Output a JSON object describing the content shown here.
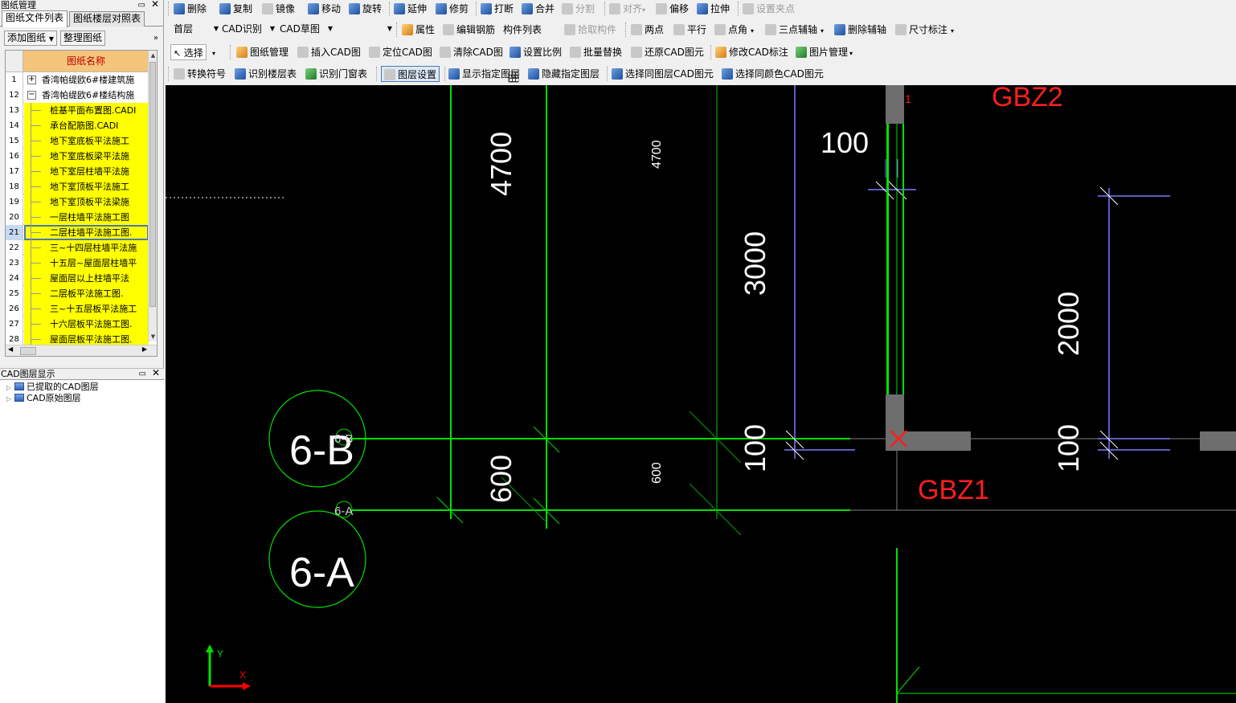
{
  "left_panel": {
    "title": "图纸管理",
    "tabs": [
      "图纸文件列表",
      "图纸楼层对照表"
    ],
    "add_button": "添加图纸",
    "organize_button": "整理图纸",
    "column_header": "图纸名称",
    "rows": [
      {
        "num": "1",
        "name": "香湾帕缇欧6#楼建筑施",
        "kind": "parent",
        "toggle": "+"
      },
      {
        "num": "12",
        "name": "香湾帕缇欧6#楼结构施",
        "kind": "parent",
        "toggle": "−"
      },
      {
        "num": "13",
        "name": "桩基平面布置图.CADI",
        "kind": "child"
      },
      {
        "num": "14",
        "name": "承台配筋图.CADI",
        "kind": "child"
      },
      {
        "num": "15",
        "name": "地下室底板平法施工",
        "kind": "child"
      },
      {
        "num": "16",
        "name": "地下室底板梁平法施",
        "kind": "child"
      },
      {
        "num": "17",
        "name": "地下室层柱墙平法施",
        "kind": "child"
      },
      {
        "num": "18",
        "name": "地下室顶板平法施工",
        "kind": "child"
      },
      {
        "num": "19",
        "name": "地下室顶板平法梁施",
        "kind": "child"
      },
      {
        "num": "20",
        "name": "一层柱墙平法施工图",
        "kind": "child"
      },
      {
        "num": "21",
        "name": "二层柱墙平法施工图.",
        "kind": "child",
        "selected": true
      },
      {
        "num": "22",
        "name": "三~十四层柱墙平法施",
        "kind": "child"
      },
      {
        "num": "23",
        "name": "十五层~屋面层柱墙平",
        "kind": "child"
      },
      {
        "num": "24",
        "name": "屋面层以上柱墙平法",
        "kind": "child"
      },
      {
        "num": "25",
        "name": "二层板平法施工图.",
        "kind": "child"
      },
      {
        "num": "26",
        "name": "三~十五层板平法施工",
        "kind": "child"
      },
      {
        "num": "27",
        "name": "十六层板平法施工图.",
        "kind": "child"
      },
      {
        "num": "28",
        "name": "屋面层板平法施工图.",
        "kind": "child"
      }
    ],
    "layers_title": "CAD图层显示",
    "layers": [
      "已提取的CAD图层",
      "CAD原始图层"
    ]
  },
  "toolbar1": [
    "删除",
    "复制",
    "镜像",
    "移动",
    "旋转",
    "延伸",
    "修剪",
    "打断",
    "合并",
    "分割",
    "对齐",
    "偏移",
    "拉伸",
    "设置夹点"
  ],
  "toolbar2": {
    "floor": "首层",
    "cad_recognize": "CAD识别",
    "cad_draft": "CAD草图",
    "items": [
      "属性",
      "编辑钢筋",
      "构件列表",
      "拾取构件",
      "两点",
      "平行",
      "点角",
      "三点辅轴",
      "删除辅轴",
      "尺寸标注"
    ]
  },
  "toolbar3": [
    "选择",
    "图纸管理",
    "插入CAD图",
    "定位CAD图",
    "清除CAD图",
    "设置比例",
    "批量替换",
    "还原CAD图元",
    "修改CAD标注",
    "图片管理"
  ],
  "toolbar4": [
    "转换符号",
    "识别楼层表",
    "识别门窗表",
    "图层设置",
    "显示指定图层",
    "隐藏指定图层",
    "选择同图层CAD图元",
    "选择同颜色CAD图元"
  ],
  "canvas": {
    "labels": {
      "gbz2": "GBZ2",
      "gbz1": "GBZ1",
      "dim_4700_big": "4700",
      "dim_4700_small": "4700",
      "dim_3000": "3000",
      "dim_2000": "2000",
      "dim_100_top": "100",
      "dim_100_mid": "100",
      "dim_100_right": "100",
      "dim_600_big": "600",
      "dim_600_small": "600",
      "axis_6b": "6-B",
      "axis_6a": "6-A",
      "axis_6b_small": "6-B",
      "axis_6a_small": "6-A",
      "ucs_y": "Y",
      "ucs_x": "X"
    },
    "colors": {
      "background": "#000000",
      "axis_line": "#00e000",
      "dim_line": "#7a7aff",
      "label_red": "#ff1e1e",
      "wall": "#6e6e6e",
      "text": "#ffffff"
    }
  }
}
